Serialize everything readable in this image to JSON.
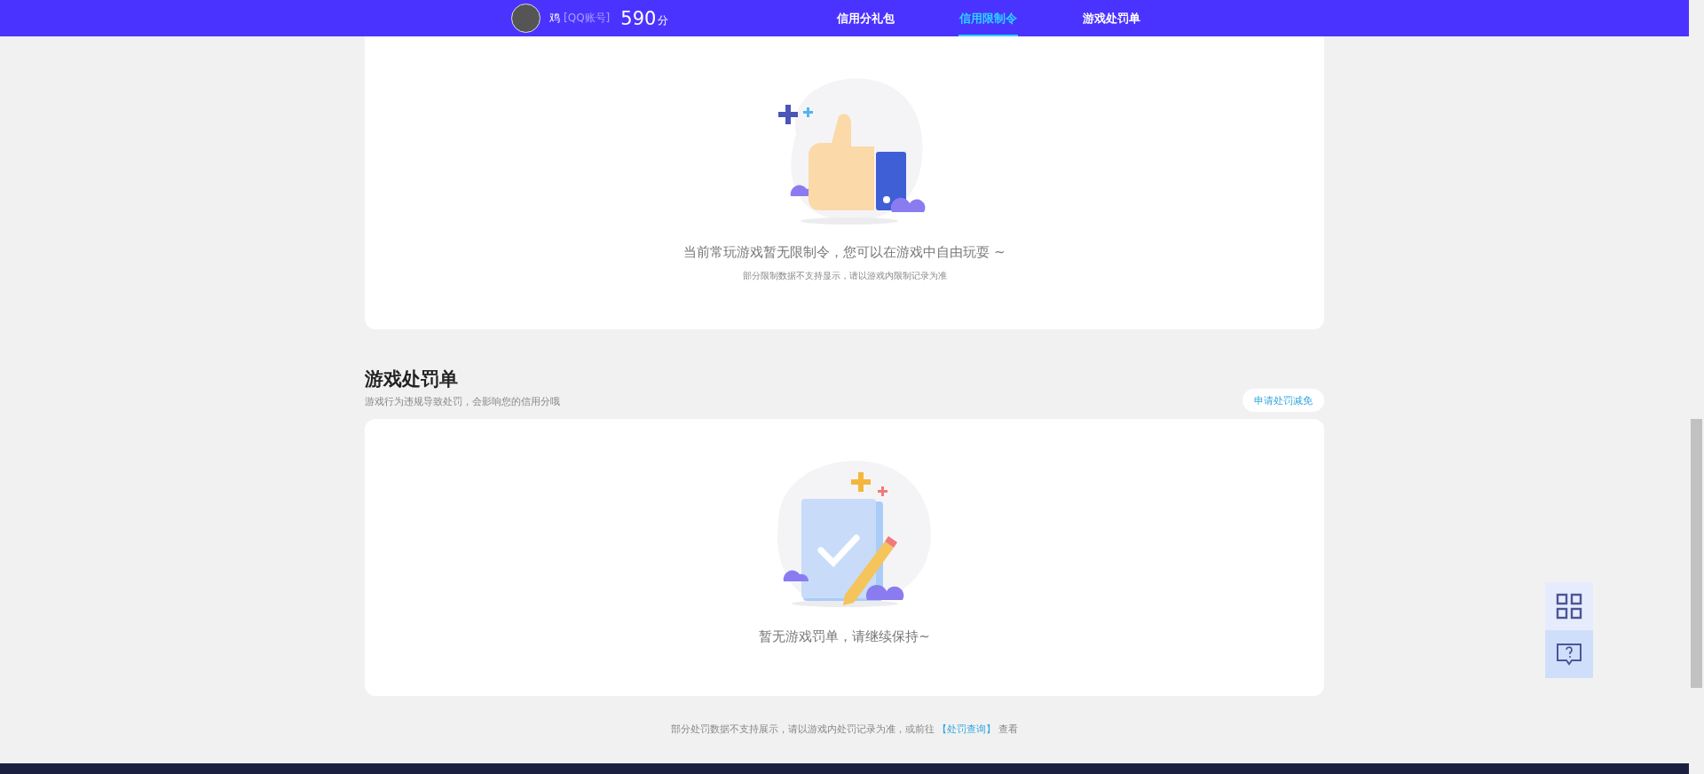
{
  "header": {
    "name": "鸡",
    "account": "[QQ账号]",
    "score": "590",
    "score_unit": "分"
  },
  "tabs": [
    {
      "label": "信用分礼包",
      "selected": false
    },
    {
      "label": "信用限制令",
      "selected": true
    },
    {
      "label": "游戏处罚单",
      "selected": false
    }
  ],
  "restriction_card": {
    "message": "当前常玩游戏暂无限制令，您可以在游戏中自由玩耍 ~",
    "note": "部分限制数据不支持显示，请以游戏内限制记录为准"
  },
  "penalty_section": {
    "title": "游戏处罚单",
    "subtitle": "游戏行为违规导致处罚，会影响您的信用分哦",
    "appeal_button": "申请处罚减免",
    "message": "暂无游戏罚单，请继续保持~"
  },
  "footer_note": {
    "text": "部分处罚数据不支持展示，请以游戏内处罚记录为准，或前往",
    "link": "【处罚查询】",
    "suffix": "查看"
  }
}
